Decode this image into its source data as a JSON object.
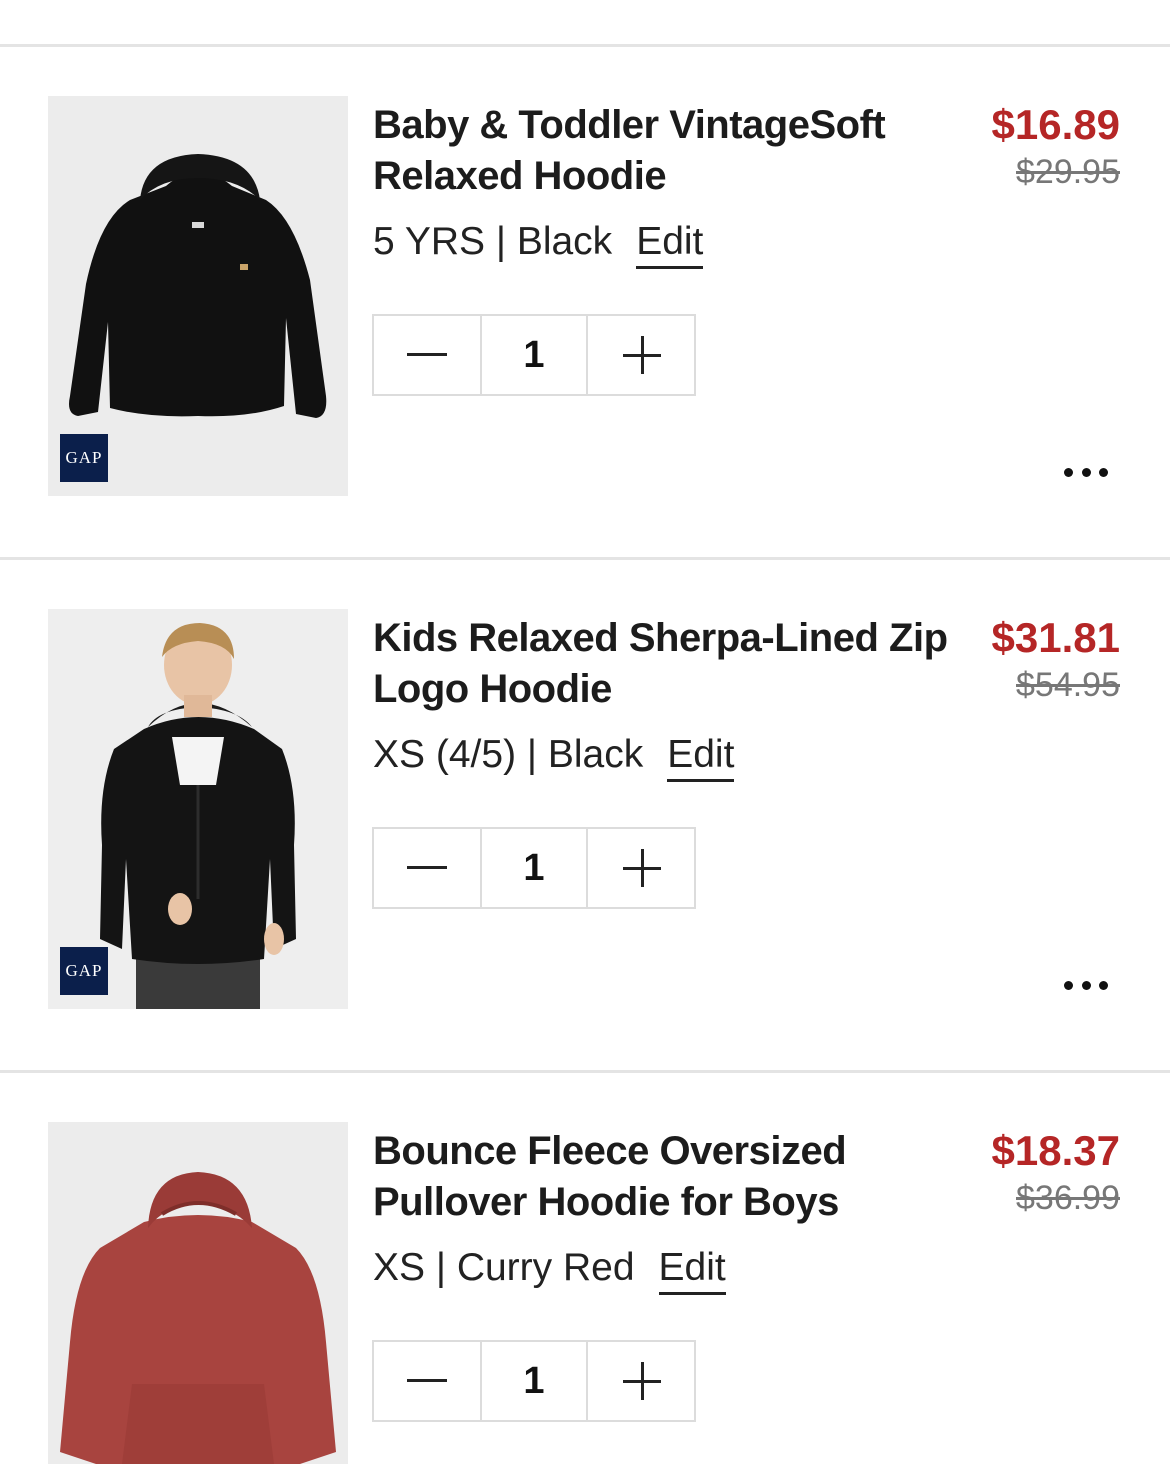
{
  "cart": {
    "items": [
      {
        "title": "Baby & Toddler VintageSoft Relaxed Hoodie",
        "variant": "5 YRS | Black",
        "edit_label": "Edit",
        "sale_price": "$16.89",
        "original_price": "$29.95",
        "quantity": "1",
        "brand_badge": "GAP",
        "image_icon": "black-hoodie-product-image"
      },
      {
        "title": "Kids Relaxed Sherpa-Lined Zip Logo Hoodie",
        "variant": "XS (4/5) | Black",
        "edit_label": "Edit",
        "sale_price": "$31.81",
        "original_price": "$54.95",
        "quantity": "1",
        "brand_badge": "GAP",
        "image_icon": "boy-in-black-zip-hoodie-product-image"
      },
      {
        "title": "Bounce Fleece Oversized Pullover Hoodie for Boys",
        "variant": "XS | Curry Red",
        "edit_label": "Edit",
        "sale_price": "$18.37",
        "original_price": "$36.99",
        "quantity": "1",
        "image_icon": "red-hoodie-product-image"
      }
    ]
  },
  "icons": {
    "decrease": "minus-icon",
    "increase": "plus-icon",
    "more": "more-options-icon"
  },
  "colors": {
    "sale_price": "#b52626",
    "original_price": "#777777",
    "gap_badge": "#0b1f4b",
    "divider": "#e4e4e4"
  }
}
